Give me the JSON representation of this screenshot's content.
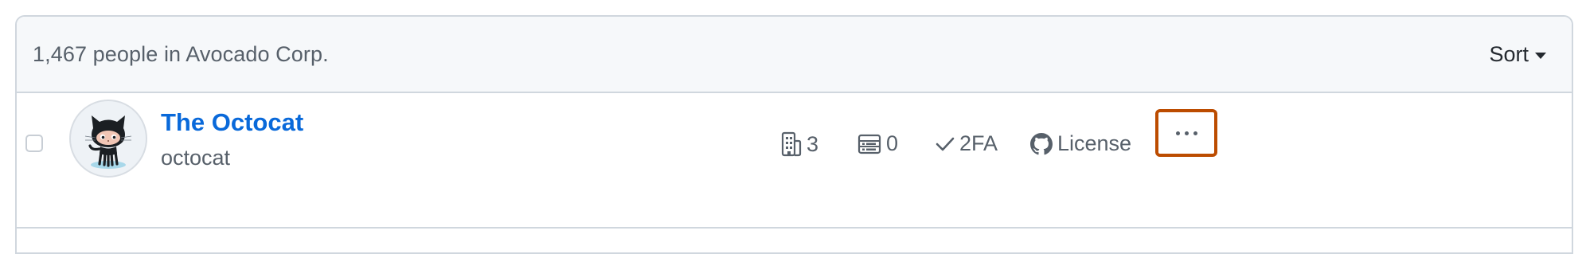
{
  "header": {
    "count_text": "1,467 people in Avocado Corp.",
    "sort_label": "Sort"
  },
  "member": {
    "display_name": "The Octocat",
    "username": "octocat",
    "teams_count": "3",
    "repos_count": "0",
    "twofa_label": "2FA",
    "license_label": "License"
  },
  "icons": {
    "teams": "organization-icon",
    "repos": "repo-list-icon",
    "twofa": "check-icon",
    "license": "github-mark-icon",
    "more": "kebab-horizontal-icon",
    "sort_caret": "triangle-down-icon"
  },
  "colors": {
    "link": "#0969da",
    "muted_text": "#57606a",
    "border": "#d0d7de",
    "header_bg": "#f6f8fa",
    "highlight": "#bc4c00"
  }
}
